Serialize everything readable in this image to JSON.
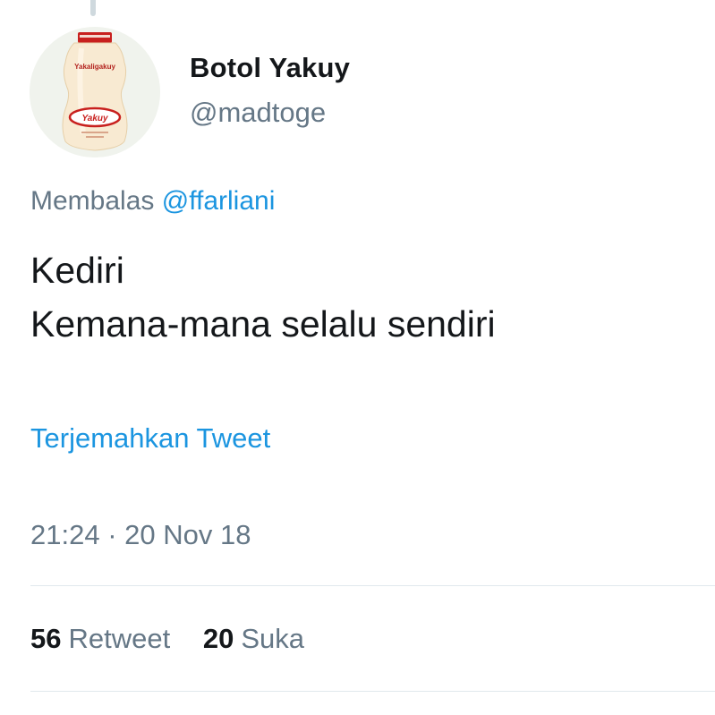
{
  "tweet": {
    "author": {
      "display_name": "Botol Yakuy",
      "handle": "@madtoge",
      "avatar_label_top": "Yakaligakuy",
      "avatar_label_logo": "Yakuy"
    },
    "reply": {
      "prefix": "Membalas",
      "mention": "@ffarliani"
    },
    "text_lines": [
      "Kediri",
      "Kemana-mana selalu sendiri"
    ],
    "translate_link": "Terjemahkan Tweet",
    "timestamp": "21:24 · 20 Nov 18",
    "stats": {
      "retweets": {
        "count": "56",
        "label": "Retweet"
      },
      "likes": {
        "count": "20",
        "label": "Suka"
      }
    }
  },
  "colors": {
    "link": "#1b95e0",
    "secondary_text": "#657786",
    "primary_text": "#14171a",
    "divider": "#e1e8ed"
  },
  "icons": [
    "yakult-bottle-avatar"
  ]
}
